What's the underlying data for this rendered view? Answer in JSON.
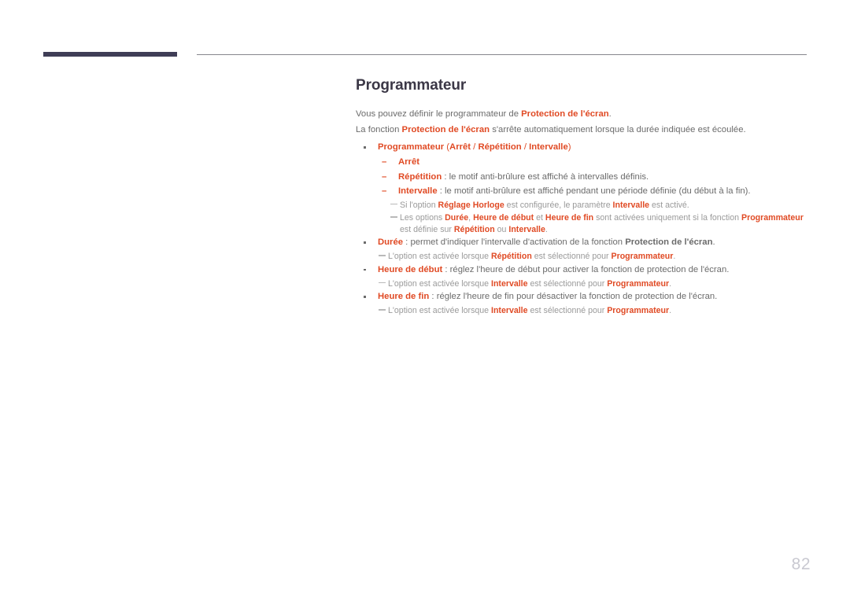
{
  "page": {
    "number": "82",
    "title": "Programmateur",
    "accent_color": "#e04a24",
    "title_color": "#3b3746",
    "body_color": "#6b6b6b",
    "note_color": "#9a9a9a",
    "header_bar_color": "#3f3d56",
    "header_rule_color": "#86868c"
  },
  "intro": [
    {
      "id": "intro-line-1",
      "tokens": [
        {
          "text": "Vous pouvez définir le programmateur de ",
          "style": "plain"
        },
        {
          "text": "Protection de l'écran",
          "style": "accent"
        },
        {
          "text": ".",
          "style": "plain"
        }
      ]
    },
    {
      "id": "intro-line-2",
      "tokens": [
        {
          "text": "La fonction ",
          "style": "plain"
        },
        {
          "text": "Protection de l'écran",
          "style": "accent"
        },
        {
          "text": " s'arrête automatiquement lorsque la durée indiquée est écoulée.",
          "style": "plain"
        }
      ]
    }
  ],
  "list": [
    {
      "id": "bullet-programmateur",
      "kind": "bullet",
      "tokens": [
        {
          "text": "Programmateur",
          "style": "accent"
        },
        {
          "text": " (",
          "style": "accent-rg"
        },
        {
          "text": "Arrêt",
          "style": "accent"
        },
        {
          "text": " / ",
          "style": "accent-rg"
        },
        {
          "text": "Répétition",
          "style": "accent"
        },
        {
          "text": " / ",
          "style": "accent-rg"
        },
        {
          "text": "Intervalle",
          "style": "accent"
        },
        {
          "text": ")",
          "style": "accent-rg"
        }
      ]
    },
    {
      "id": "sub-arret",
      "kind": "sub",
      "marker": "–",
      "tokens": [
        {
          "text": "Arrêt",
          "style": "accent"
        }
      ]
    },
    {
      "id": "sub-repetition",
      "kind": "sub",
      "marker": "–",
      "tokens": [
        {
          "text": "Répétition",
          "style": "accent"
        },
        {
          "text": " : le motif anti-brûlure est affiché à intervalles définis.",
          "style": "plain"
        }
      ]
    },
    {
      "id": "sub-intervalle",
      "kind": "sub",
      "marker": "–",
      "tokens": [
        {
          "text": "Intervalle",
          "style": "accent"
        },
        {
          "text": " : le motif anti-brûlure est affiché pendant une période définie (du début à la fin).",
          "style": "plain"
        }
      ]
    },
    {
      "id": "note-reglage-horloge",
      "kind": "note",
      "indent": "deep",
      "tokens": [
        {
          "text": "Si l'option ",
          "style": "plain"
        },
        {
          "text": "Réglage Horloge",
          "style": "note-strong"
        },
        {
          "text": " est configurée, le paramètre ",
          "style": "plain"
        },
        {
          "text": "Intervalle",
          "style": "note-strong"
        },
        {
          "text": " est activé.",
          "style": "plain"
        }
      ]
    },
    {
      "id": "note-options-activees",
      "kind": "note",
      "indent": "deep",
      "tokens": [
        {
          "text": "Les options ",
          "style": "plain"
        },
        {
          "text": "Durée",
          "style": "note-strong"
        },
        {
          "text": ", ",
          "style": "plain"
        },
        {
          "text": "Heure de début",
          "style": "note-strong"
        },
        {
          "text": " et ",
          "style": "plain"
        },
        {
          "text": "Heure de fin",
          "style": "note-strong"
        },
        {
          "text": " sont activées uniquement si la fonction ",
          "style": "plain"
        },
        {
          "text": "Programmateur",
          "style": "note-strong"
        },
        {
          "text": " est définie sur ",
          "style": "plain"
        },
        {
          "text": "Répétition",
          "style": "note-strong"
        },
        {
          "text": " ou ",
          "style": "plain"
        },
        {
          "text": "Intervalle",
          "style": "note-strong"
        },
        {
          "text": ".",
          "style": "plain"
        }
      ]
    },
    {
      "id": "bullet-duree",
      "kind": "bullet",
      "tokens": [
        {
          "text": "Durée",
          "style": "accent"
        },
        {
          "text": " : permet d'indiquer l'intervalle d'activation de la fonction ",
          "style": "plain"
        },
        {
          "text": "Protection de l'écran",
          "style": "strong"
        },
        {
          "text": ".",
          "style": "plain"
        }
      ]
    },
    {
      "id": "note-duree",
      "kind": "note",
      "indent": "normal",
      "tokens": [
        {
          "text": "L'option est activée lorsque ",
          "style": "plain"
        },
        {
          "text": "Répétition",
          "style": "note-strong"
        },
        {
          "text": " est sélectionné pour ",
          "style": "plain"
        },
        {
          "text": "Programmateur",
          "style": "note-strong"
        },
        {
          "text": ".",
          "style": "plain"
        }
      ]
    },
    {
      "id": "bullet-heure-debut",
      "kind": "bullet",
      "tokens": [
        {
          "text": "Heure de début",
          "style": "accent"
        },
        {
          "text": " : réglez l'heure de début pour activer la fonction de protection de l'écran.",
          "style": "plain"
        }
      ]
    },
    {
      "id": "note-heure-debut",
      "kind": "note",
      "indent": "normal",
      "tokens": [
        {
          "text": "L'option est activée lorsque ",
          "style": "plain"
        },
        {
          "text": "Intervalle",
          "style": "note-strong"
        },
        {
          "text": " est sélectionné pour ",
          "style": "plain"
        },
        {
          "text": "Programmateur",
          "style": "note-strong"
        },
        {
          "text": ".",
          "style": "plain"
        }
      ]
    },
    {
      "id": "bullet-heure-fin",
      "kind": "bullet",
      "tokens": [
        {
          "text": "Heure de fin",
          "style": "accent"
        },
        {
          "text": " : réglez l'heure de fin pour désactiver la fonction de protection de l'écran.",
          "style": "plain"
        }
      ]
    },
    {
      "id": "note-heure-fin",
      "kind": "note",
      "indent": "normal",
      "tokens": [
        {
          "text": "L'option est activée lorsque ",
          "style": "plain"
        },
        {
          "text": "Intervalle",
          "style": "note-strong"
        },
        {
          "text": " est sélectionné pour ",
          "style": "plain"
        },
        {
          "text": "Programmateur",
          "style": "note-strong"
        },
        {
          "text": ".",
          "style": "plain"
        }
      ]
    }
  ]
}
